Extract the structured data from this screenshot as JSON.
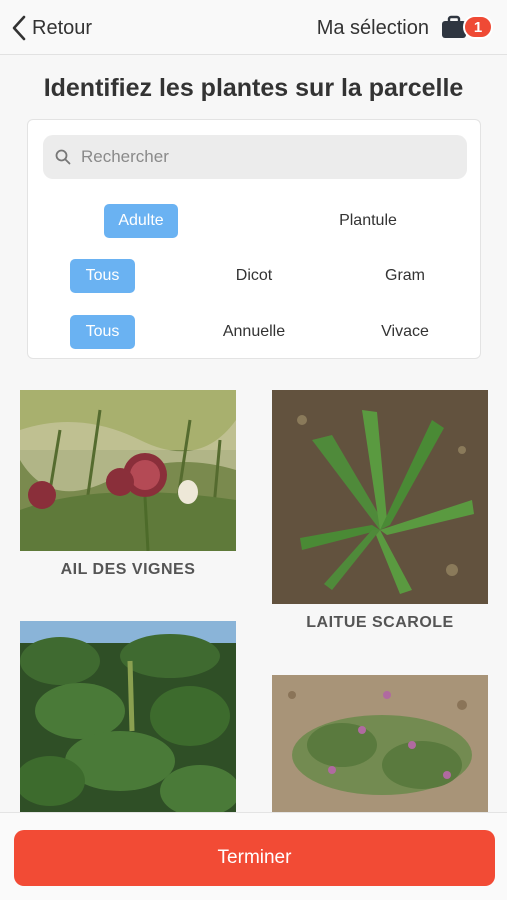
{
  "nav": {
    "back_label": "Retour",
    "selection_label": "Ma sélection",
    "selection_count": "1"
  },
  "title": "Identifiez les plantes sur la parcelle",
  "search": {
    "placeholder": "Rechercher",
    "value": ""
  },
  "filters": {
    "stage": [
      {
        "label": "Adulte",
        "active": true
      },
      {
        "label": "Plantule",
        "active": false
      }
    ],
    "family": [
      {
        "label": "Tous",
        "active": true
      },
      {
        "label": "Dicot",
        "active": false
      },
      {
        "label": "Gram",
        "active": false
      }
    ],
    "cycle": [
      {
        "label": "Tous",
        "active": true
      },
      {
        "label": "Annuelle",
        "active": false
      },
      {
        "label": "Vivace",
        "active": false
      }
    ]
  },
  "plants": [
    {
      "name": "AIL DES VIGNES",
      "icon": "plant-photo"
    },
    {
      "name": "LAITUE SCAROLE",
      "icon": "plant-photo"
    },
    {
      "name": "",
      "icon": "plant-photo"
    },
    {
      "name": "",
      "icon": "plant-photo"
    }
  ],
  "footer": {
    "finish_label": "Terminer"
  },
  "colors": {
    "accent_blue": "#6ab2f2",
    "accent_red": "#f24b35",
    "badge_red": "#ef4a35"
  }
}
